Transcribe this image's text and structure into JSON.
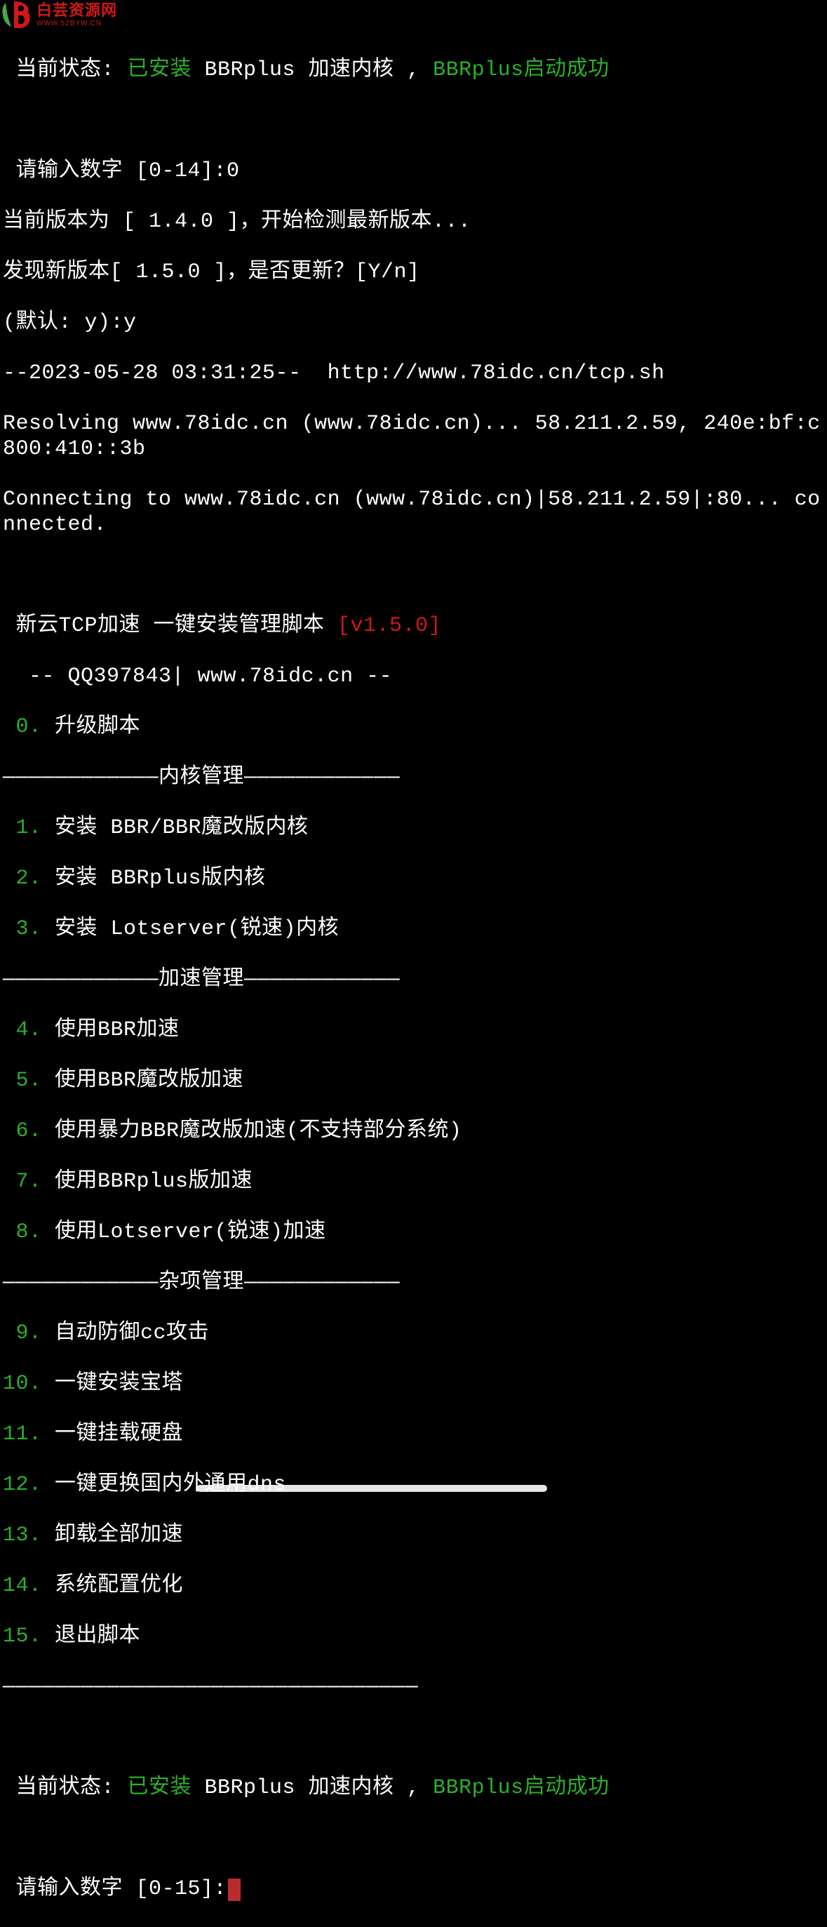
{
  "watermark": {
    "title": "白芸资源网",
    "url": "WWW.52BYW.CN"
  },
  "status1": {
    "prefix": " 当前状态: ",
    "installed": "已安装",
    "kernel": " BBRplus 加速内核 , ",
    "success": "BBRplus启动成功"
  },
  "prompt1": " 请输入数字 [0-14]:0",
  "version_current": "当前版本为 [ 1.4.0 ]，开始检测最新版本...",
  "version_new": "发现新版本[ 1.5.0 ]，是否更新？[Y/n]",
  "default_prompt": "(默认: y):y",
  "wget": "--2023-05-28 03:31:25--  http://www.78idc.cn/tcp.sh",
  "resolving": "Resolving www.78idc.cn (www.78idc.cn)... 58.211.2.59, 240e:bf:c800:410::3b",
  "connecting": "Connecting to www.78idc.cn (www.78idc.cn)|58.211.2.59|:80... connected.",
  "title": {
    "text": " 新云TCP加速 一键安装管理脚本 ",
    "version": "[v1.5.0]"
  },
  "contact": "  -- QQ397843| www.78idc.cn --",
  "menu": {
    "item0": {
      "num": " 0.",
      "text": " 升级脚本"
    },
    "sep1": "————————————内核管理————————————",
    "item1": {
      "num": " 1.",
      "text": " 安装 BBR/BBR魔改版内核"
    },
    "item2": {
      "num": " 2.",
      "text": " 安装 BBRplus版内核"
    },
    "item3": {
      "num": " 3.",
      "text": " 安装 Lotserver(锐速)内核"
    },
    "sep2": "————————————加速管理————————————",
    "item4": {
      "num": " 4.",
      "text": " 使用BBR加速"
    },
    "item5": {
      "num": " 5.",
      "text": " 使用BBR魔改版加速"
    },
    "item6": {
      "num": " 6.",
      "text": " 使用暴力BBR魔改版加速(不支持部分系统)"
    },
    "item7": {
      "num": " 7.",
      "text": " 使用BBRplus版加速"
    },
    "item8": {
      "num": " 8.",
      "text": " 使用Lotserver(锐速)加速"
    },
    "sep3": "————————————杂项管理————————————",
    "item9": {
      "num": " 9.",
      "text": " 自动防御cc攻击"
    },
    "item10": {
      "num": "10.",
      "text": " 一键安装宝塔"
    },
    "item11": {
      "num": "11.",
      "text": " 一键挂载硬盘"
    },
    "item12": {
      "num": "12.",
      "text": " 一键更换国内外通用dns"
    },
    "item13": {
      "num": "13.",
      "text": " 卸载全部加速"
    },
    "item14": {
      "num": "14.",
      "text": " 系统配置优化"
    },
    "item15": {
      "num": "15.",
      "text": " 退出脚本"
    },
    "sep4": "————————————————————————————————"
  },
  "status2": {
    "prefix": " 当前状态: ",
    "installed": "已安装",
    "kernel": " BBRplus 加速内核 , ",
    "success": "BBRplus启动成功"
  },
  "prompt2": " 请输入数字 [0-15]:"
}
